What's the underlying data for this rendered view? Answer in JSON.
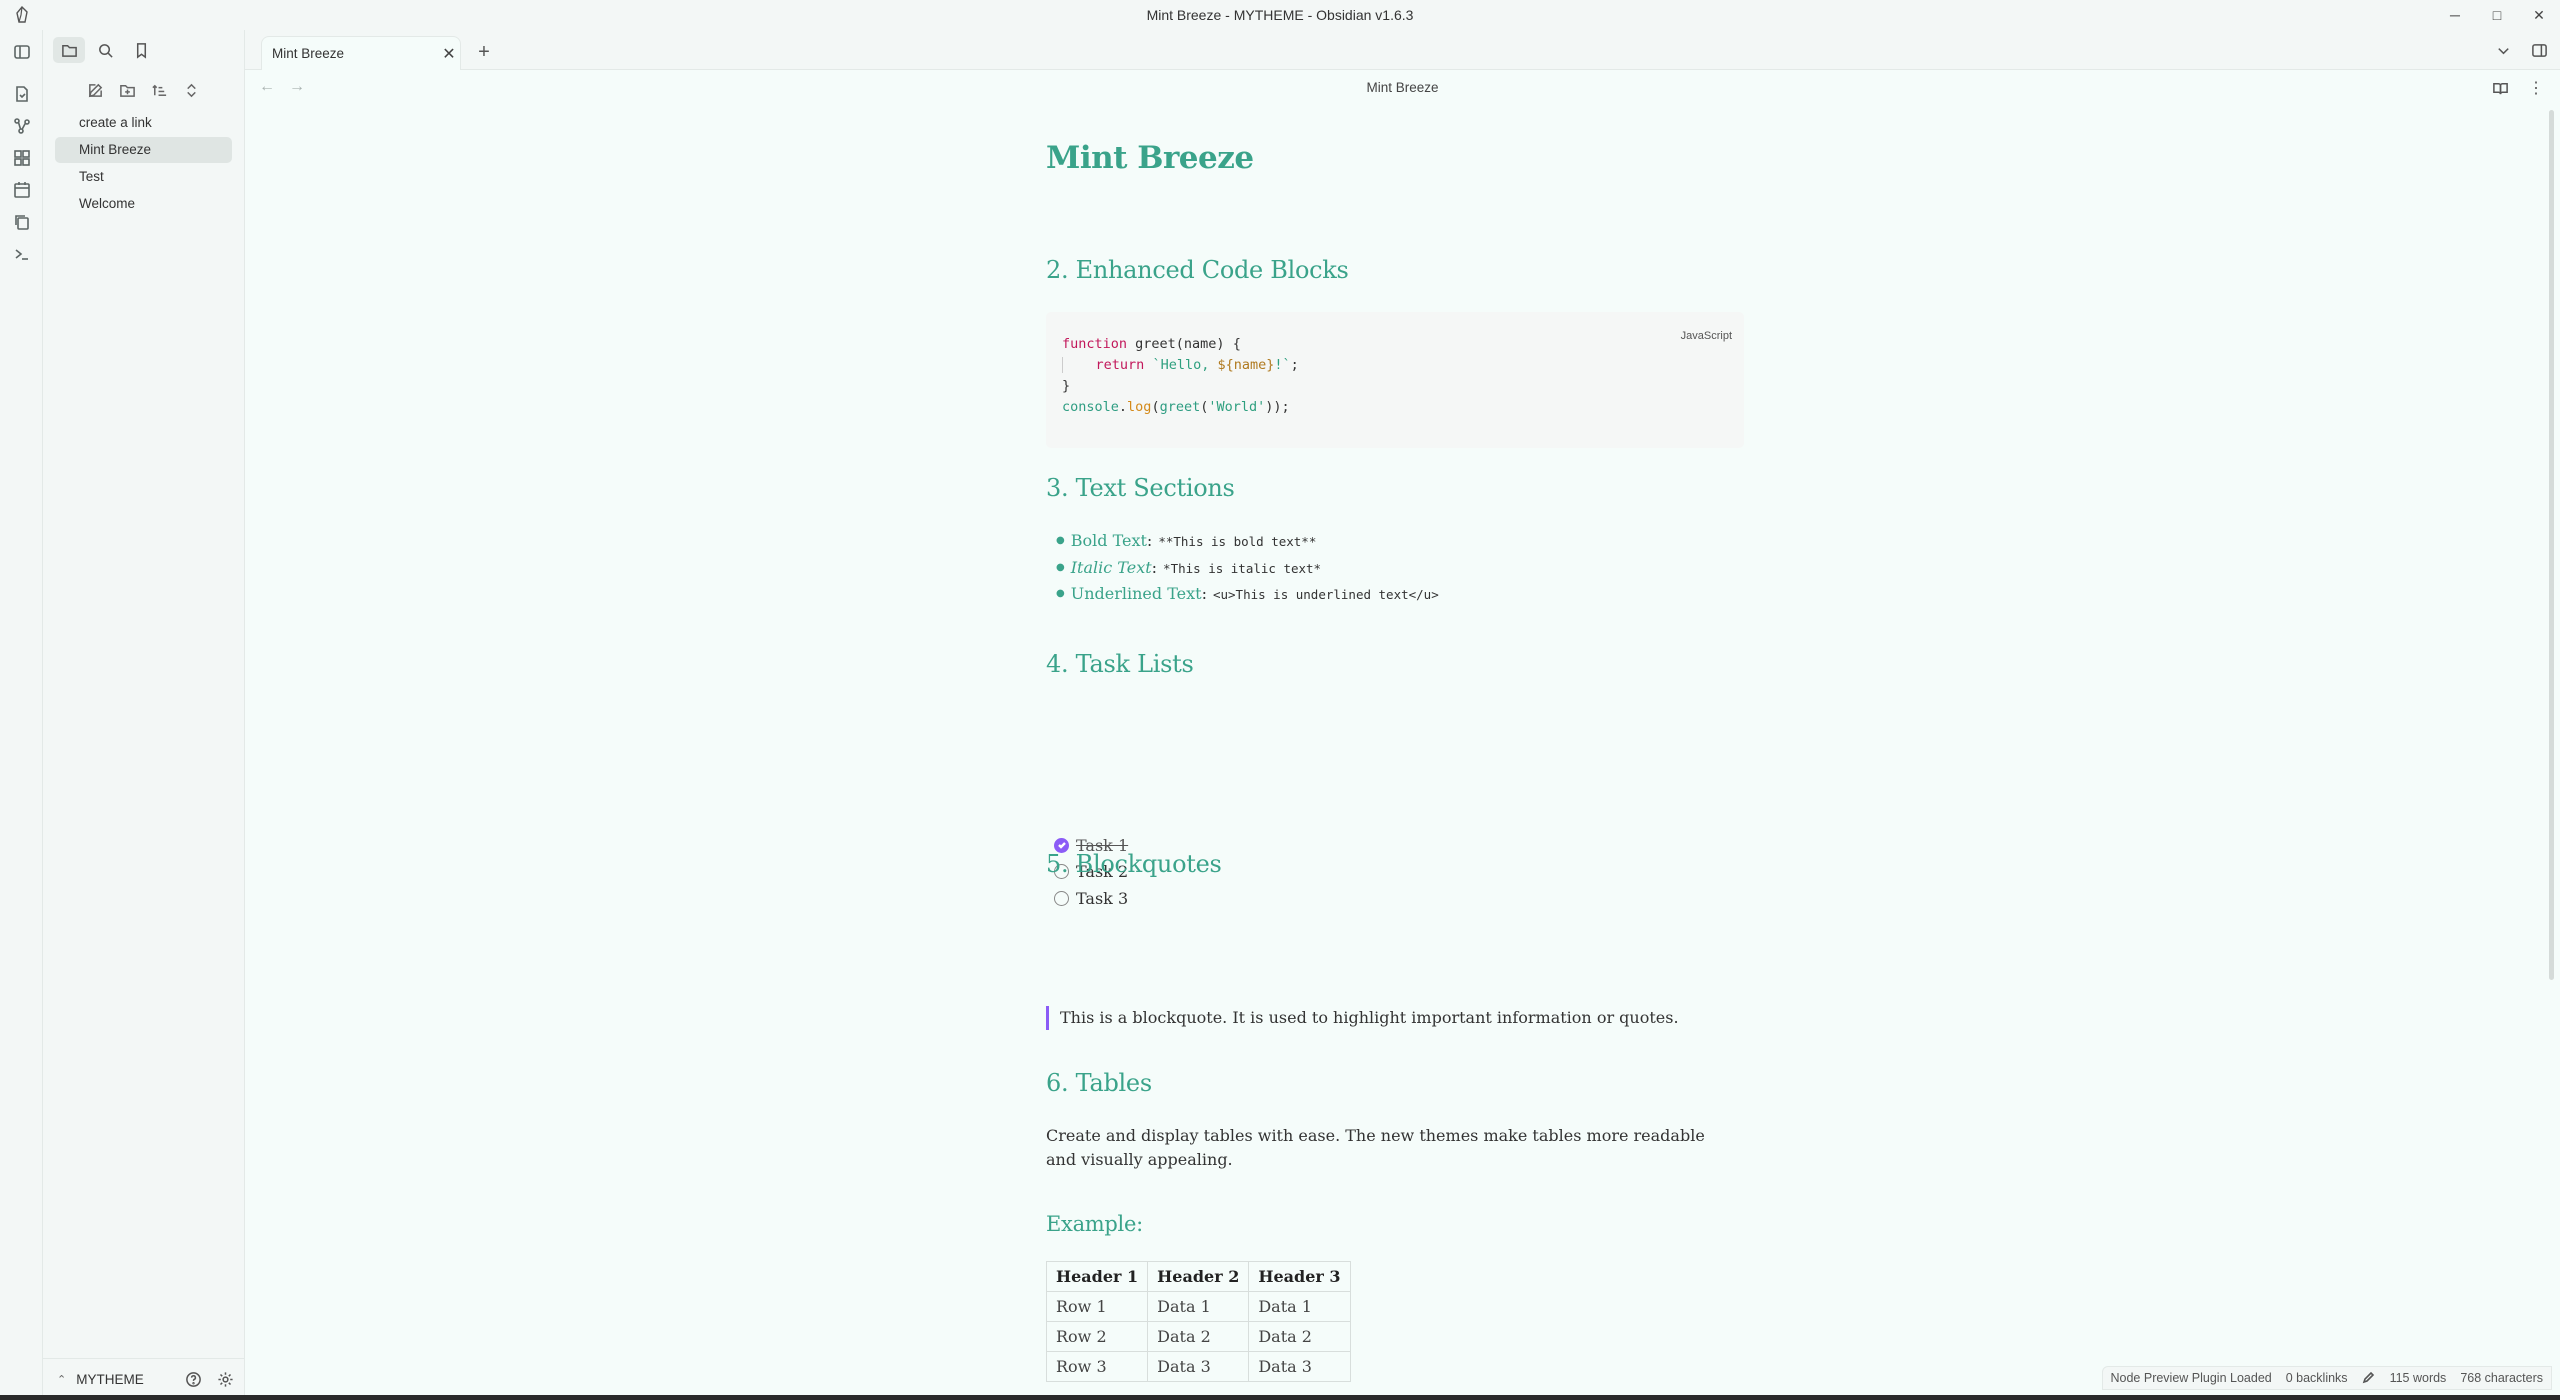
{
  "window": {
    "title": "Mint Breeze - MYTHEME - Obsidian v1.6.3",
    "controls": [
      "─",
      "□",
      "✕"
    ]
  },
  "sidebar": {
    "files": [
      "create a link",
      "Mint Breeze",
      "Test",
      "Welcome"
    ],
    "active_file": "Mint Breeze",
    "vault_name": "MYTHEME"
  },
  "tabs": {
    "active_label": "Mint Breeze",
    "close_glyph": "✕",
    "new_glyph": "+"
  },
  "view": {
    "title": "Mint Breeze",
    "back_glyph": "←",
    "forward_glyph": "→",
    "more_glyph": "⋮"
  },
  "doc": {
    "title": "Mint Breeze",
    "section2": "2. Enhanced Code Blocks",
    "code_lang": "JavaScript",
    "section3": "3. Text Sections",
    "bullets": [
      {
        "label": "Bold Text",
        "code": "**This is bold text**"
      },
      {
        "label": "Italic Text",
        "code": "*This is italic text*"
      },
      {
        "label": "Underlined Text",
        "code": "<u>This is underlined text</u>"
      }
    ],
    "colon": ":",
    "section4": "4. Task Lists",
    "tasks": [
      "Task 1",
      "Task 2",
      "Task 3"
    ],
    "section5": "5. Blockquotes",
    "blockquote": "This is a blockquote. It is used to highlight important information or quotes.",
    "section6": "6. Tables",
    "tables_paragraph": "Create and display tables with ease. The new themes make tables more readable and visually appealing.",
    "example_heading": "Example:",
    "table": {
      "headers": [
        "Header 1",
        "Header 2",
        "Header 3"
      ],
      "rows": [
        [
          "Row 1",
          "Data 1",
          "Data 1"
        ],
        [
          "Row 2",
          "Data 2",
          "Data 2"
        ],
        [
          "Row 3",
          "Data 3",
          "Data 3"
        ]
      ]
    }
  },
  "status": {
    "plugin": "Node Preview Plugin Loaded",
    "backlinks": "0 backlinks",
    "words": "115 words",
    "characters": "768 characters"
  },
  "colors": {
    "accent": "#3aa38a",
    "task_checked": "#8b5cf6",
    "background": "#f5fcfa"
  }
}
